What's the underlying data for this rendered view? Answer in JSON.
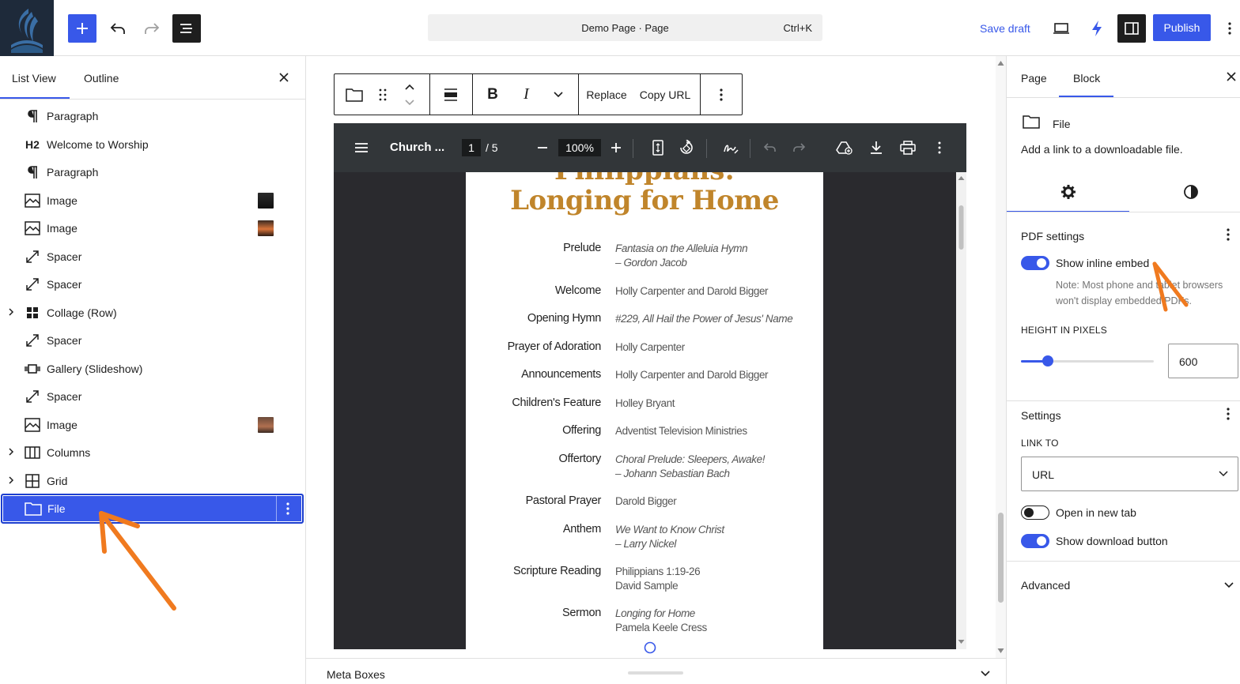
{
  "topbar": {
    "command_title": "Demo Page · Page",
    "command_shortcut": "Ctrl+K",
    "save_draft": "Save draft",
    "publish": "Publish"
  },
  "list_view": {
    "tabs": [
      "List View",
      "Outline"
    ],
    "items": [
      {
        "label": "Paragraph",
        "icon": "paragraph-icon"
      },
      {
        "label": "Welcome to Worship",
        "icon": "heading-icon",
        "badge": "H2"
      },
      {
        "label": "Paragraph",
        "icon": "paragraph-icon"
      },
      {
        "label": "Image",
        "icon": "image-icon"
      },
      {
        "label": "Image",
        "icon": "image-icon"
      },
      {
        "label": "Spacer",
        "icon": "spacer-icon"
      },
      {
        "label": "Spacer",
        "icon": "spacer-icon"
      },
      {
        "label": "Collage (Row)",
        "icon": "grid-icon"
      },
      {
        "label": "Spacer",
        "icon": "spacer-icon"
      },
      {
        "label": "Gallery (Slideshow)",
        "icon": "slideshow-icon"
      },
      {
        "label": "Spacer",
        "icon": "spacer-icon"
      },
      {
        "label": "Image",
        "icon": "image-icon"
      },
      {
        "label": "Columns",
        "icon": "columns-icon"
      },
      {
        "label": "Grid",
        "icon": "grid-layout-icon"
      },
      {
        "label": "File",
        "icon": "file-icon",
        "selected": true
      }
    ]
  },
  "block_toolbar": {
    "replace": "Replace",
    "copy_url": "Copy URL"
  },
  "pdf": {
    "doc_title": "Church ...",
    "page": "1",
    "total": "/ 5",
    "zoom": "100%",
    "heading_top": "Philippians:",
    "heading": "Longing for Home",
    "program": [
      {
        "label": "Prelude",
        "value": "Fantasia on the Alleluia Hymn",
        "value2": "– Gordon Jacob",
        "italic": true
      },
      {
        "label": "Welcome",
        "value": "Holly Carpenter and Darold Bigger"
      },
      {
        "label": "Opening Hymn",
        "value": "#229, All Hail the Power of Jesus' Name",
        "italic": true
      },
      {
        "label": "Prayer of Adoration",
        "value": "Holly Carpenter"
      },
      {
        "label": "Announcements",
        "value": "Holly Carpenter and Darold Bigger"
      },
      {
        "label": "Children's Feature",
        "value": "Holley Bryant"
      },
      {
        "label": "Offering",
        "value": "Adventist Television Ministries"
      },
      {
        "label": "Offertory",
        "value": "Choral Prelude: Sleepers, Awake!",
        "value2": "– Johann Sebastian Bach",
        "italic": true
      },
      {
        "label": "Pastoral Prayer",
        "value": "Darold Bigger"
      },
      {
        "label": "Anthem",
        "value": "We Want to Know Christ",
        "value2": "– Larry Nickel",
        "italic": true
      },
      {
        "label": "Scripture Reading",
        "value": "Philippians 1:19-26",
        "value2": "David Sample"
      },
      {
        "label": "Sermon",
        "value": "Longing for Home",
        "value2": "Pamela Keele Cress",
        "italic_first": true
      }
    ]
  },
  "meta_boxes": "Meta Boxes",
  "sidebar": {
    "tabs": [
      "Page",
      "Block"
    ],
    "block_name": "File",
    "block_desc": "Add a link to a downloadable file.",
    "pdf_settings_title": "PDF settings",
    "show_inline_embed": "Show inline embed",
    "note_line1": "Note: Most phone and tablet browsers",
    "note_line2": "won't display embedded PDFs.",
    "height_label": "HEIGHT IN PIXELS",
    "height_value": "600",
    "height_slider_level": 0.2,
    "settings_title": "Settings",
    "link_to_label": "LINK TO",
    "link_to_value": "URL",
    "open_new_tab": "Open in new tab",
    "show_download": "Show download button",
    "advanced": "Advanced"
  },
  "colors": {
    "accent": "#3858e9",
    "heading_gold": "#c0852b",
    "annotation_arrow": "#f07a1f"
  }
}
